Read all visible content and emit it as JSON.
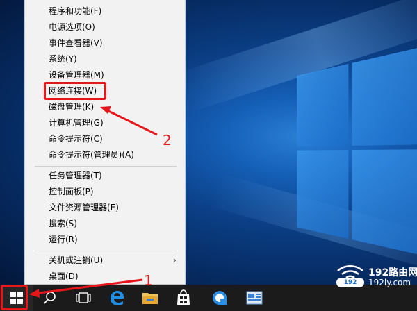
{
  "context_menu": {
    "items": [
      {
        "label": "程序和功能(F)"
      },
      {
        "label": "电源选项(O)"
      },
      {
        "label": "事件查看器(V)"
      },
      {
        "label": "系统(Y)"
      },
      {
        "label": "设备管理器(M)"
      },
      {
        "label": "网络连接(W)"
      },
      {
        "label": "磁盘管理(K)"
      },
      {
        "label": "计算机管理(G)"
      },
      {
        "label": "命令提示符(C)"
      },
      {
        "label": "命令提示符(管理员)(A)"
      },
      {
        "label": "任务管理器(T)"
      },
      {
        "label": "控制面板(P)"
      },
      {
        "label": "文件资源管理器(E)"
      },
      {
        "label": "搜索(S)"
      },
      {
        "label": "运行(R)"
      },
      {
        "label": "关机或注销(U)"
      },
      {
        "label": "桌面(D)"
      }
    ]
  },
  "annotations": {
    "step1": "1",
    "step2": "2",
    "color": "#e8151b"
  },
  "watermark": {
    "line1": "192路由网",
    "line2": "192ly.com",
    "pill": "192"
  },
  "taskbar": {
    "icons": [
      "windows-start-icon",
      "search-icon",
      "task-view-icon",
      "edge-icon",
      "file-explorer-icon",
      "store-icon",
      "cortana-icon",
      "app-icon"
    ]
  }
}
